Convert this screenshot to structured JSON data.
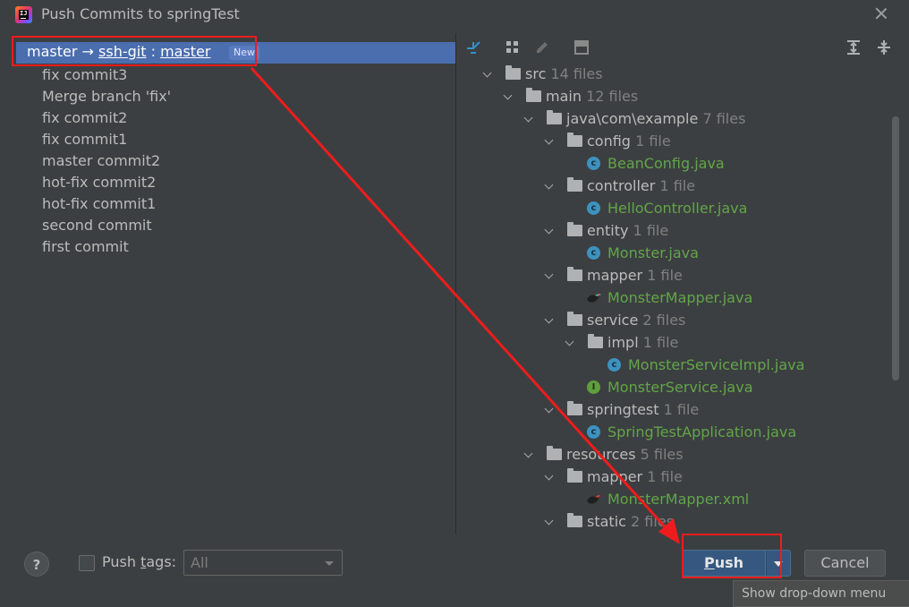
{
  "window": {
    "title": "Push Commits to springTest"
  },
  "branch": {
    "local": "master",
    "arrow": "→",
    "remote": "ssh-git",
    "sep": ":",
    "target": "master",
    "badge": "New"
  },
  "commits": [
    "fix commit3",
    "Merge branch 'fix'",
    "fix commit2",
    "fix commit1",
    "master commit2",
    "hot-fix commit2",
    "hot-fix commit1",
    "second commit",
    "first commit"
  ],
  "tree": [
    {
      "name": "src",
      "count": "14 files"
    },
    {
      "name": "main",
      "count": "12 files"
    },
    {
      "name": "java\\com\\example",
      "count": "7 files"
    },
    {
      "name": "config",
      "count": "1 file"
    },
    {
      "name": "BeanConfig.java"
    },
    {
      "name": "controller",
      "count": "1 file"
    },
    {
      "name": "HelloController.java"
    },
    {
      "name": "entity",
      "count": "1 file"
    },
    {
      "name": "Monster.java"
    },
    {
      "name": "mapper",
      "count": "1 file"
    },
    {
      "name": "MonsterMapper.java"
    },
    {
      "name": "service",
      "count": "2 files"
    },
    {
      "name": "impl",
      "count": "1 file"
    },
    {
      "name": "MonsterServiceImpl.java"
    },
    {
      "name": "MonsterService.java"
    },
    {
      "name": "springtest",
      "count": "1 file"
    },
    {
      "name": "SpringTestApplication.java"
    },
    {
      "name": "resources",
      "count": "5 files"
    },
    {
      "name": "mapper",
      "count": "1 file"
    },
    {
      "name": "MonsterMapper.xml"
    },
    {
      "name": "static",
      "count": "2 files"
    }
  ],
  "bottom": {
    "help": "?",
    "push_tags_pre": "Push ",
    "push_tags_ul": "t",
    "push_tags_post": "ags:",
    "tags_value": "All",
    "push_ul": "P",
    "push_rest": "ush",
    "cancel": "Cancel",
    "tooltip": "Show drop-down menu"
  },
  "colors": {
    "selection": "#4b6eaf",
    "annotation": "#ee1c1c",
    "java_file": "#62a549"
  }
}
